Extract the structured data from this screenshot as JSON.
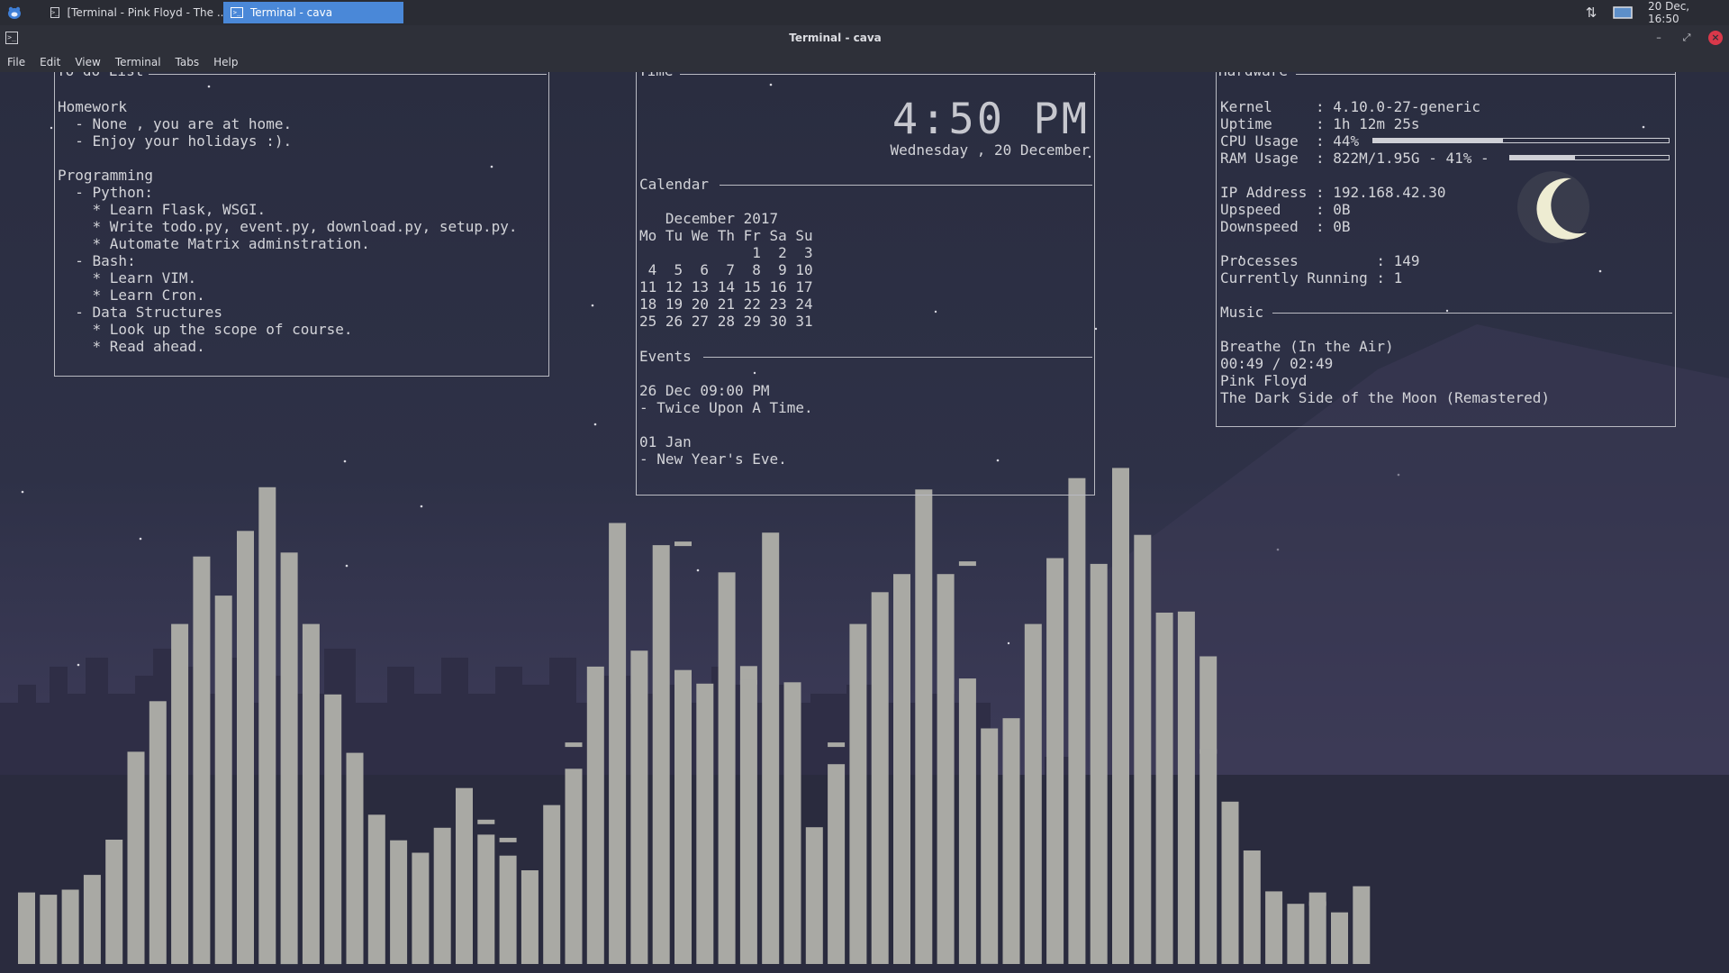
{
  "panel": {
    "tasks": [
      {
        "label": "[Terminal - Pink Floyd - The ..."
      },
      {
        "label": "Terminal - cava"
      }
    ],
    "clock": "20 Dec, 16:50",
    "icons": {
      "menu": "xfce-mouse-icon",
      "task": "terminal-icon",
      "network": "network-transfer-icon",
      "display": "display-icon"
    }
  },
  "window": {
    "title": "Terminal - cava",
    "buttons": {
      "minimize": "–",
      "maximize": "⤢",
      "close": "×"
    }
  },
  "menubar": [
    "File",
    "Edit",
    "View",
    "Terminal",
    "Tabs",
    "Help"
  ],
  "todo": {
    "title": "To-do List",
    "lines": [
      "Homework",
      "  - None , you are at home.",
      "  - Enjoy your holidays :).",
      "",
      "Programming",
      "  - Python:",
      "    * Learn Flask, WSGI.",
      "    * Write todo.py, event.py, download.py, setup.py.",
      "    * Automate Matrix adminstration.",
      "  - Bash:",
      "    * Learn VIM.",
      "    * Learn Cron.",
      "  - Data Structures",
      "    * Look up the scope of course.",
      "    * Read ahead."
    ]
  },
  "time": {
    "title": "Time",
    "clock": "4:50 PM",
    "date": "Wednesday , 20 December",
    "calendar_header": "Calendar",
    "calendar_lines": [
      "   December 2017",
      "Mo Tu We Th Fr Sa Su",
      "             1  2  3",
      " 4  5  6  7  8  9 10",
      "11 12 13 14 15 16 17",
      "18 19 20 21 22 23 24",
      "25 26 27 28 29 30 31"
    ],
    "events_header": "Events",
    "events_lines": [
      "26 Dec 09:00 PM",
      "- Twice Upon A Time.",
      "",
      "01 Jan",
      "- New Year's Eve."
    ]
  },
  "hardware": {
    "title": "Hardware",
    "kernel": "Kernel     : 4.10.0-27-generic",
    "uptime": "Uptime     : 1h 12m 25s",
    "cpu": "CPU Usage  : 44%",
    "cpu_fraction": 0.44,
    "ram": "RAM Usage  : 822M/1.95G - 41% -",
    "ram_fraction": 0.41,
    "ip": "IP Address : 192.168.42.30",
    "upspeed": "Upspeed    : 0B",
    "downspeed": "Downspeed  : 0B",
    "processes": "Processes         : 149",
    "running": "Currently Running : 1",
    "music_header": "Music",
    "track": "Breathe (In the Air)",
    "position": "00:49 / 02:49",
    "artist": "Pink Floyd",
    "album": "The Dark Side of the Moon (Remastered)"
  },
  "visualizer": {
    "bar_color": "#a9a9a4",
    "levels": [
      0.126,
      0.122,
      0.131,
      0.157,
      0.219,
      0.374,
      0.463,
      0.599,
      0.718,
      0.649,
      0.763,
      0.84,
      0.725,
      0.599,
      0.475,
      0.372,
      0.263,
      0.218,
      0.196,
      0.24,
      0.31,
      0.228,
      0.191,
      0.165,
      0.28,
      0.344,
      0.524,
      0.777,
      0.552,
      0.738,
      0.518,
      0.494,
      0.69,
      0.525,
      0.76,
      0.492,
      0.241,
      0.352,
      0.599,
      0.655,
      0.687,
      0.836,
      0.687,
      0.503,
      0.415,
      0.433,
      0.599,
      0.715,
      0.856,
      0.705,
      0.874,
      0.756,
      0.619,
      0.621,
      0.542,
      0.286,
      0.2,
      0.128,
      0.106,
      0.126,
      0.091,
      0.137
    ],
    "peaks": [
      null,
      null,
      null,
      null,
      null,
      null,
      null,
      null,
      null,
      null,
      null,
      null,
      null,
      null,
      null,
      null,
      null,
      null,
      null,
      null,
      0.235,
      0.248,
      0.216,
      null,
      null,
      0.384,
      null,
      null,
      null,
      null,
      0.738,
      null,
      null,
      0.494,
      null,
      0.49,
      null,
      0.384,
      null,
      null,
      null,
      null,
      null,
      0.703,
      null,
      null,
      null,
      null,
      null,
      null,
      null,
      null,
      null,
      null,
      0.372,
      null,
      null,
      null,
      null,
      0.104,
      null,
      null
    ]
  }
}
